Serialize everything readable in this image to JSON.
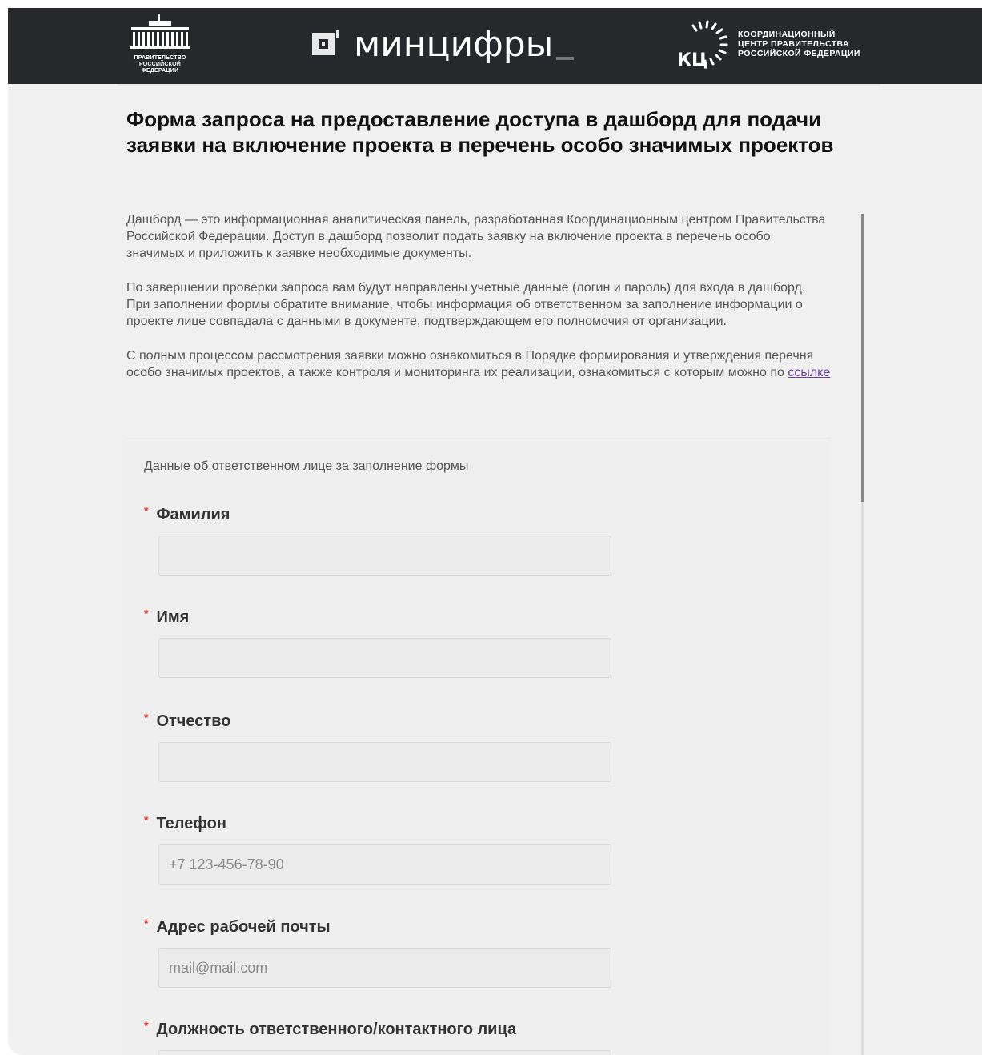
{
  "header": {
    "gov_logo_text": "ПРАВИТЕЛЬСТВО\nРОССИЙСКОЙ\nФЕДЕРАЦИИ",
    "ministry_logo_text": "минцифры",
    "kc_logo_text": "КООРДИНАЦИОННЫЙ\nЦЕНТР ПРАВИТЕЛЬСТВА\nРОССИЙСКОЙ ФЕДЕРАЦИИ",
    "kc_letters": "КЦ"
  },
  "page": {
    "title": "Форма запроса на предоставление доступа в дашборд для подачи заявки на включение проекта в перечень особо значимых проектов",
    "intro_1": "Дашборд — это информационная аналитическая панель, разработанная Координационным центром Правительства Российской Федерации. Доступ в дашборд позволит подать заявку на включение проекта в перечень особо значимых и приложить к заявке необходимые документы.",
    "intro_2": "По завершении проверки запроса вам будут направлены учетные данные (логин и пароль) для входа в дашборд. При заполнении формы обратите внимание, чтобы информация об ответственном за заполнение информации о проекте лице совпадала с данными в документе, подтверждающем его полномочия от организации.",
    "intro_3": "С полным процессом рассмотрения заявки можно ознакомиться в Порядке формирования и утверждения перечня особо значимых проектов, а также контроля и мониторинга их реализации, ознакомиться с которым можно по",
    "intro_link": "ссылке"
  },
  "form": {
    "section_title": "Данные об ответственном лице за заполнение формы",
    "required_mark": "*",
    "fields": [
      {
        "label": "Фамилия",
        "value": "",
        "placeholder": ""
      },
      {
        "label": "Имя",
        "value": "",
        "placeholder": ""
      },
      {
        "label": "Отчество",
        "value": "",
        "placeholder": ""
      },
      {
        "label": "Телефон",
        "value": "",
        "placeholder": "+7 123-456-78-90"
      },
      {
        "label": "Адрес рабочей почты",
        "value": "",
        "placeholder": "mail@mail.com"
      },
      {
        "label": "Должность ответственного/контактного лица",
        "value": "",
        "placeholder": ""
      }
    ]
  },
  "colors": {
    "header_bg": "#26282c",
    "page_bg": "#f0f0f0",
    "required": "#e0322a",
    "link": "#6a3fa0"
  }
}
